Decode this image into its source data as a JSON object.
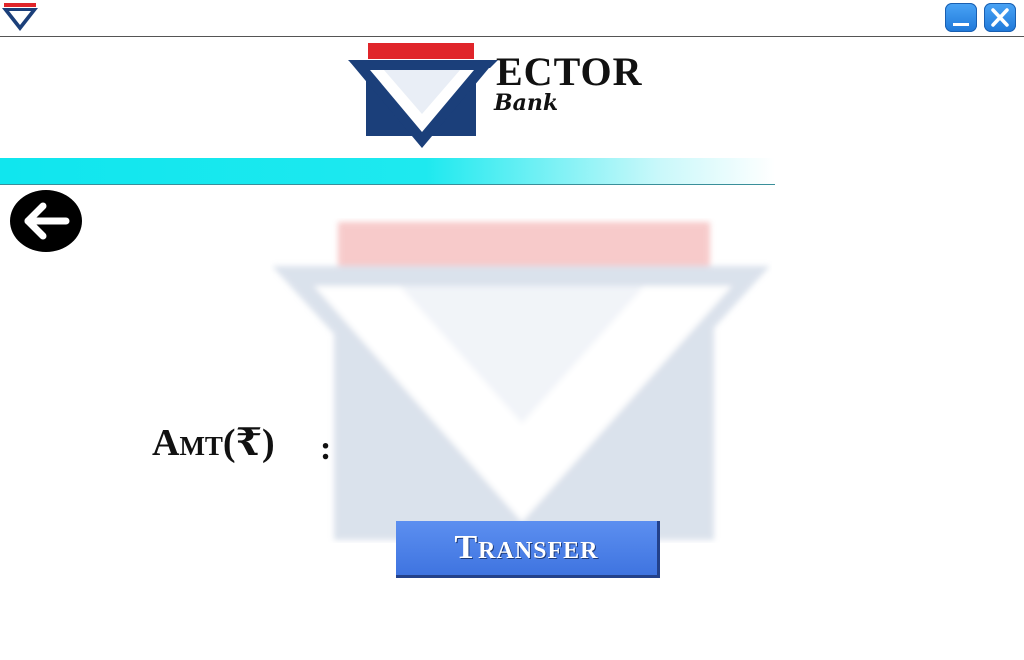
{
  "window": {
    "app_icon": "vector-bank-v-icon",
    "minimize_icon": "minimize-icon",
    "close_icon": "close-icon",
    "button_color": "#2f8ae8"
  },
  "brand": {
    "word": "ECTOR",
    "sub": "Bank",
    "colors": {
      "navy": "#1b3f7a",
      "red": "#e0252a",
      "cyan": "#10e6ee"
    }
  },
  "navigation": {
    "back_icon": "arrow-left-icon"
  },
  "form": {
    "amount_label": "Amt(₹)",
    "colon": ":",
    "amount_value": "",
    "transfer_label": "Transfer",
    "transfer_color": "#4a7fe6"
  }
}
